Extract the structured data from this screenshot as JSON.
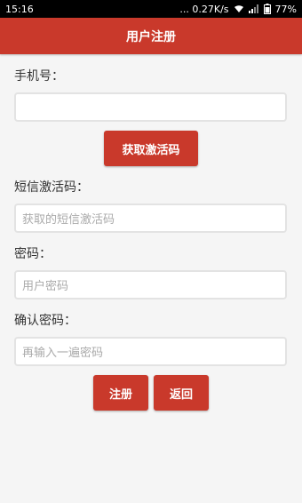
{
  "status_bar": {
    "time": "15:16",
    "network_speed": "... 0.27K/s",
    "battery": "77%",
    "icons": [
      "wifi-icon",
      "signal-icon",
      "battery-icon"
    ]
  },
  "header": {
    "title": "用户注册"
  },
  "form": {
    "phone_label": "手机号：",
    "phone_placeholder": "",
    "get_code_label": "获取激活码",
    "sms_code_label": "短信激活码：",
    "sms_code_placeholder": "获取的短信激活码",
    "password_label": "密码：",
    "password_placeholder": "用户密码",
    "confirm_label": "确认密码：",
    "confirm_placeholder": "再输入一遍密码",
    "register_label": "注册",
    "back_label": "返回"
  },
  "colors": {
    "accent": "#c9392b",
    "background": "#f5f5f5",
    "input_border": "#e3e3e3"
  }
}
